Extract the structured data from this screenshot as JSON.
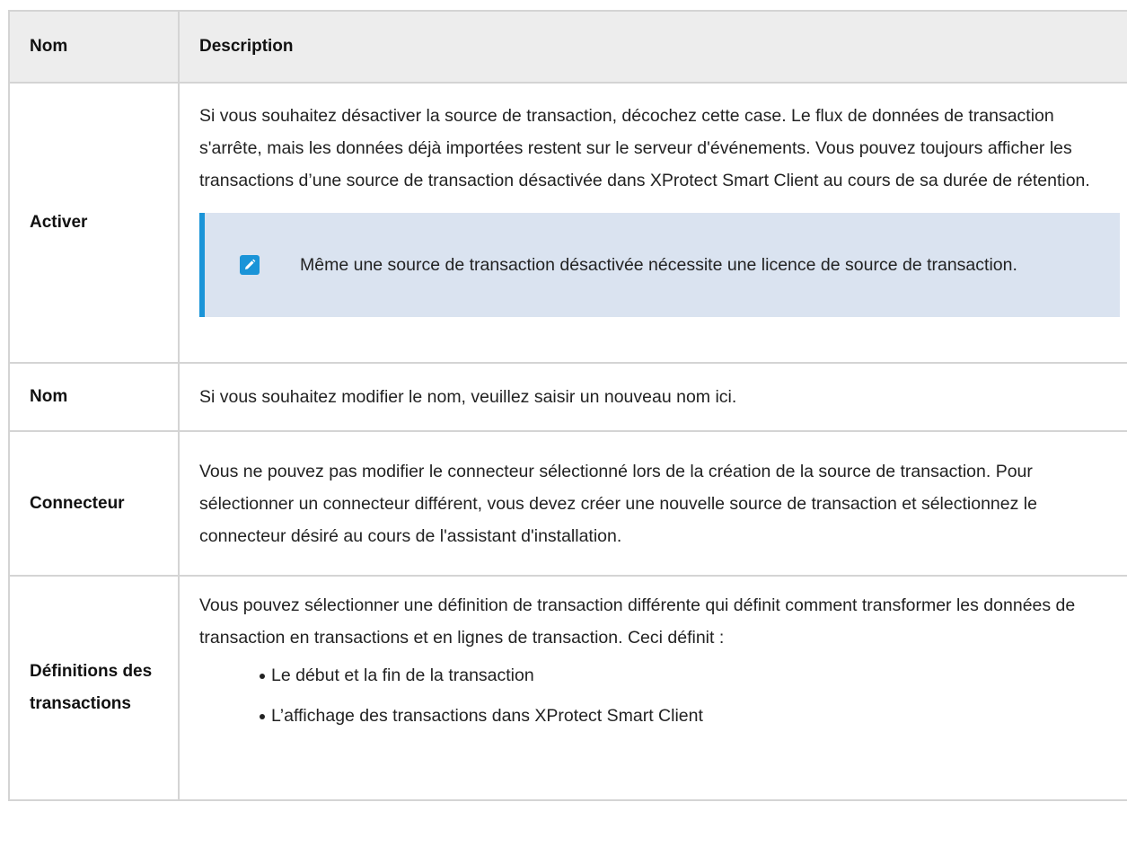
{
  "table": {
    "headers": {
      "name": "Nom",
      "description": "Description"
    },
    "rows": {
      "activer": {
        "name": "Activer",
        "description": "Si vous souhaitez désactiver la source de transaction, décochez cette case. Le flux de données de transaction s'arrête, mais les données déjà importées restent sur le serveur d'événements. Vous pouvez toujours afficher les transactions d’une source de transaction désactivée dans XProtect Smart Client au cours de sa durée de rétention.",
        "note": {
          "icon": "pencil-icon",
          "text": "Même une source de transaction désactivée nécessite une licence de source de transaction."
        }
      },
      "nom": {
        "name": "Nom",
        "description": "Si vous souhaitez modifier le nom, veuillez saisir un nouveau nom ici."
      },
      "connecteur": {
        "name": "Connecteur",
        "description": "Vous ne pouvez pas modifier le connecteur sélectionné lors de la création de la source de transaction. Pour sélectionner un connecteur différent, vous devez créer une nouvelle source de transaction et sélectionnez le connecteur désiré au cours de l'assistant d'installation."
      },
      "definitions": {
        "name": "Définitions des transactions",
        "description": "Vous pouvez sélectionner une définition de transaction différente qui définit comment transformer les données de transaction en transactions et en lignes de transaction. Ceci définit :",
        "bullets": [
          "Le début et la fin de la transaction",
          "L’affichage des transactions dans XProtect Smart Client"
        ]
      }
    }
  },
  "colors": {
    "accent": "#1a94d8",
    "note_bg": "#dae3f0",
    "header_bg": "#ededed",
    "border": "#d4d4d4"
  }
}
